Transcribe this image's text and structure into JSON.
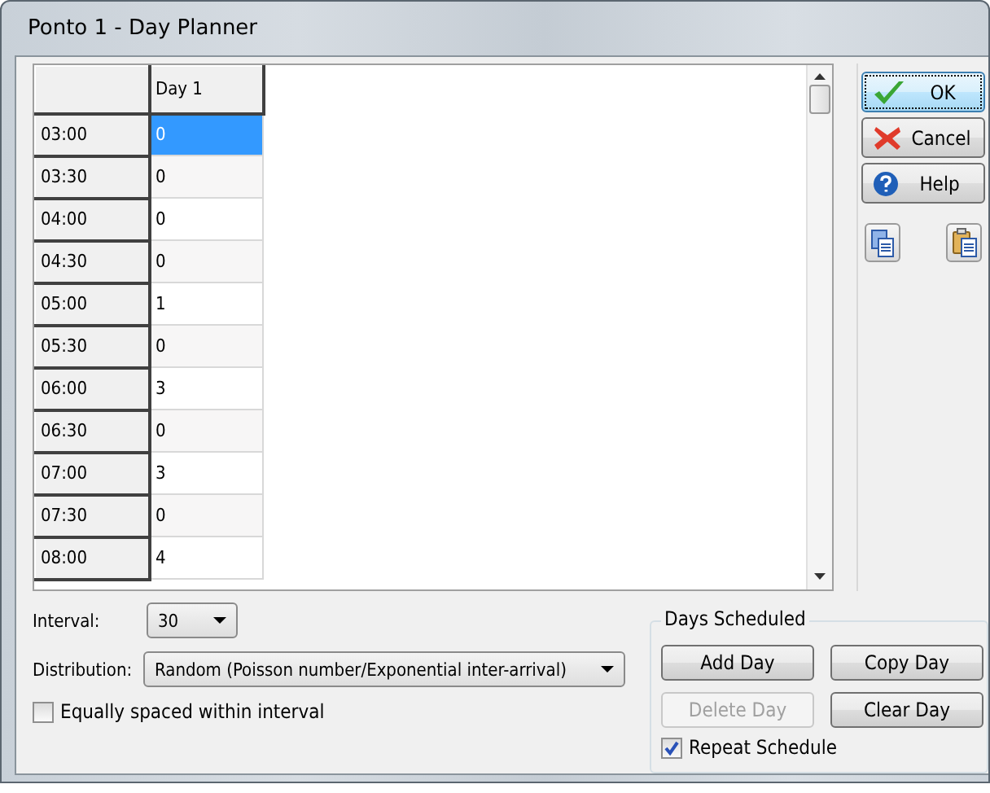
{
  "window": {
    "title": "Ponto 1 - Day Planner"
  },
  "grid": {
    "columns": [
      {
        "label": "Day 1"
      }
    ],
    "rows": [
      {
        "time": "03:00",
        "value": "0",
        "selected": true
      },
      {
        "time": "03:30",
        "value": "0",
        "selected": false
      },
      {
        "time": "04:00",
        "value": "0",
        "selected": false
      },
      {
        "time": "04:30",
        "value": "0",
        "selected": false
      },
      {
        "time": "05:00",
        "value": "1",
        "selected": false
      },
      {
        "time": "05:30",
        "value": "0",
        "selected": false
      },
      {
        "time": "06:00",
        "value": "3",
        "selected": false
      },
      {
        "time": "06:30",
        "value": "0",
        "selected": false
      },
      {
        "time": "07:00",
        "value": "3",
        "selected": false
      },
      {
        "time": "07:30",
        "value": "0",
        "selected": false
      },
      {
        "time": "08:00",
        "value": "4",
        "selected": false
      }
    ]
  },
  "side_buttons": [
    {
      "kind": "ok",
      "label": "OK",
      "focused": true
    },
    {
      "kind": "cancel",
      "label": "Cancel",
      "focused": false
    },
    {
      "kind": "help",
      "label": "Help",
      "focused": false
    }
  ],
  "tool_buttons": [
    {
      "kind": "copy"
    },
    {
      "kind": "paste"
    }
  ],
  "interval": {
    "label": "Interval:",
    "value": "30"
  },
  "distribution": {
    "label": "Distribution:",
    "value": "Random (Poisson number/Exponential inter-arrival)"
  },
  "equally_spaced": {
    "label": "Equally spaced within interval",
    "checked": false
  },
  "days_scheduled": {
    "title": "Days Scheduled",
    "buttons": [
      {
        "label": "Add Day",
        "disabled": false
      },
      {
        "label": "Copy Day",
        "disabled": false
      },
      {
        "label": "Delete Day",
        "disabled": true
      },
      {
        "label": "Clear Day",
        "disabled": false
      }
    ],
    "repeat": {
      "label": "Repeat Schedule",
      "checked": true
    }
  }
}
